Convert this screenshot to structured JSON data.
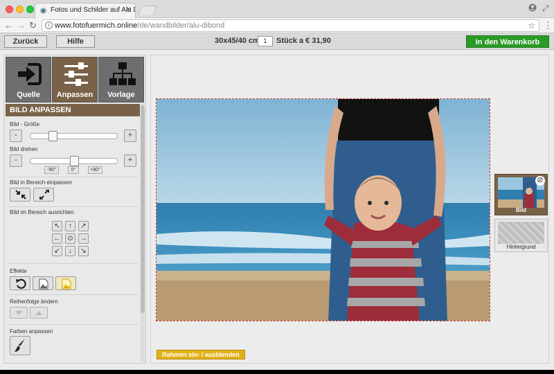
{
  "browser": {
    "tab_title": "Fotos und Schilder auf Alu Di",
    "url_host": "www.fotofuermich.online",
    "url_path": "/de/wandbilder/alu-dibond",
    "colors": {
      "close": "#ff5f57",
      "minimize": "#febc2e",
      "maximize": "#28c840"
    }
  },
  "toolbar": {
    "back_label": "Zurück",
    "help_label": "Hilfe",
    "size_label": "30x45/40 cm",
    "quantity_value": "1",
    "price_label": "Stück a € 31,90",
    "cart_label": "In den Warenkorb",
    "cart_color": "#2b9a27"
  },
  "mode_tabs": [
    {
      "label": "Quelle",
      "icon": "enter-icon",
      "active": false
    },
    {
      "label": "Anpassen",
      "icon": "sliders-icon",
      "active": true
    },
    {
      "label": "Vorlage",
      "icon": "hierarchy-icon",
      "active": false
    }
  ],
  "panel": {
    "title": "BILD ANPASSEN",
    "accent_color": "#7a6248",
    "size_label": "Bild - Größe",
    "size_minus": "-",
    "size_plus": "+",
    "size_value": 0.24,
    "rotate_label": "Bild drehen",
    "rotate_minus": "-",
    "rotate_plus": "+",
    "rotate_ticks": [
      "-90°",
      "0°",
      "+90°"
    ],
    "fit_label": "Bild in Bereich einpassen",
    "align_label": "Bild im Bereich ausrichten",
    "effects_label": "Effekte",
    "order_label": "Reihenfolge ändern",
    "colors_label": "Farben anpassen"
  },
  "canvas": {
    "frame_toggle_label": "Rahmen ein- / ausblenden",
    "frame_toggle_color": "#e2b21a",
    "layers": [
      {
        "label": "Bild",
        "active": true
      },
      {
        "label": "Hintergrund",
        "active": false
      }
    ]
  }
}
